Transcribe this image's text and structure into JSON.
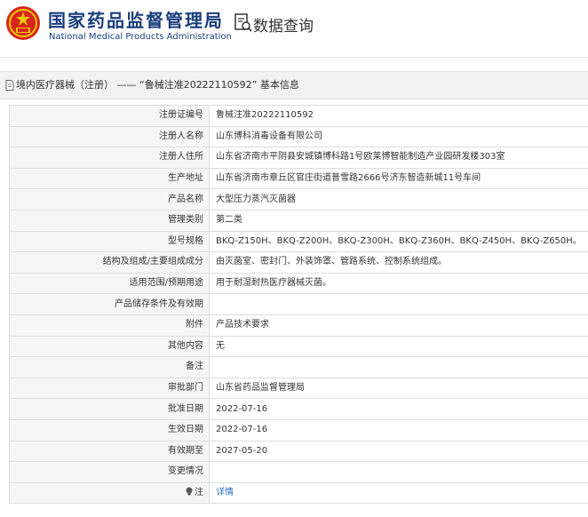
{
  "header": {
    "brand_cn": "国家药品监督管理局",
    "brand_en": "National Medical Products Administration",
    "query_title": "数据查询"
  },
  "breadcrumb": {
    "text": "境内医疗器械（注册） —— “鲁械注准20222110592” 基本信息"
  },
  "rows": [
    {
      "label": "注册证编号",
      "value": "鲁械注准20222110592"
    },
    {
      "label": "注册人名称",
      "value": "山东博科消毒设备有限公司"
    },
    {
      "label": "注册人住所",
      "value": "山东省济南市平阴县安城镇博科路1号欧莱博智能制造产业园研发楼303室"
    },
    {
      "label": "生产地址",
      "value": "山东省济南市章丘区官庄街道普雪路2666号济东智造新城11号车间"
    },
    {
      "label": "产品名称",
      "value": "大型压力蒸汽灭菌器"
    },
    {
      "label": "管理类别",
      "value": "第二类"
    },
    {
      "label": "型号规格",
      "value": "BKQ-Z150H、BKQ-Z200H、BKQ-Z300H、BKQ-Z360H、BKQ-Z450H、BKQ-Z650H。"
    },
    {
      "label": "结构及组成/主要组成成分",
      "value": "由灭菌室、密封门、外装饰罩、管路系统、控制系统组成。"
    },
    {
      "label": "适用范围/预期用途",
      "value": "用于耐湿耐热医疗器械灭菌。"
    },
    {
      "label": "产品储存条件及有效期",
      "value": ""
    },
    {
      "label": "附件",
      "value": "产品技术要求"
    },
    {
      "label": "其他内容",
      "value": "无"
    },
    {
      "label": "备注",
      "value": ""
    },
    {
      "label": "审批部门",
      "value": "山东省药品监督管理局"
    },
    {
      "label": "批准日期",
      "value": "2022-07-16"
    },
    {
      "label": "生效日期",
      "value": "2022-07-16"
    },
    {
      "label": "有效期至",
      "value": "2027-05-20"
    },
    {
      "label": "变更情况",
      "value": ""
    }
  ],
  "note_row": {
    "label": "注",
    "link": "详情"
  },
  "colors": {
    "brand": "#1a3d7c",
    "emblem_red": "#d7261c",
    "emblem_gold": "#f5c400",
    "link": "#2b6cc4"
  }
}
